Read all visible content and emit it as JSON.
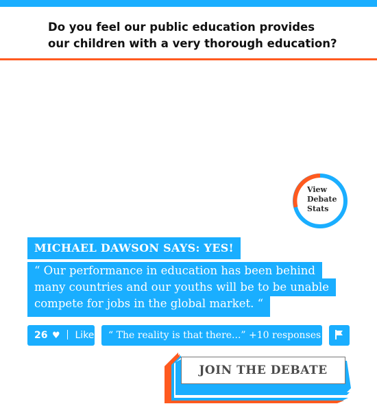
{
  "question": {
    "line1": "Do you feel our public education provides",
    "line2": "our children with a very thorough education?"
  },
  "stats": {
    "line1": "View",
    "line2": "Debate",
    "line3": "Stats"
  },
  "argument": {
    "author_heading": "MICHAEL DAWSON SAYS: YES!",
    "quote_lines": [
      "“ Our performance in education has been behind",
      "many countries and our youths will be to be unable",
      "compete for jobs in the global market. “"
    ]
  },
  "actions": {
    "like_count": "26",
    "like_label": "Like",
    "responses_text": "“ The reality is that there...” +10 responses"
  },
  "join_button": "JOIN THE DEBATE",
  "colors": {
    "accent_blue": "#1aaeff",
    "accent_orange": "#ff5a1f"
  }
}
